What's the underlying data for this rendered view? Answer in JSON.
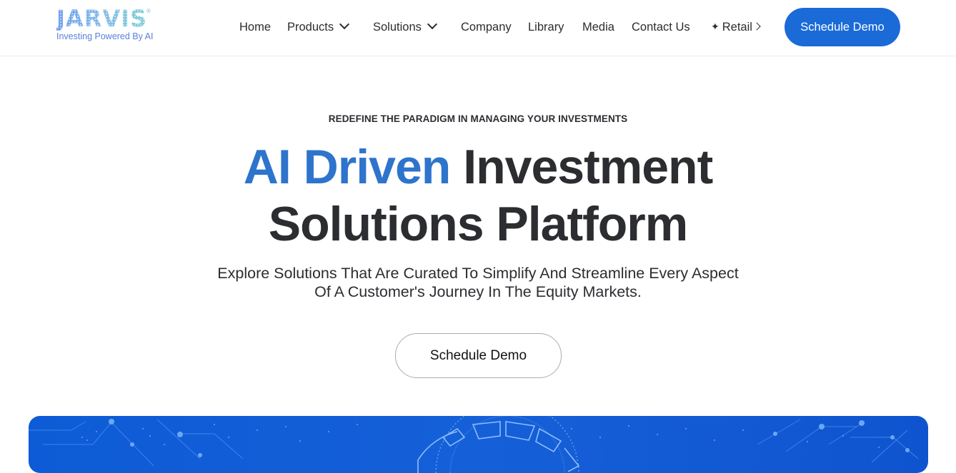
{
  "header": {
    "logo": {
      "wordmark": "JARVIS",
      "registered": "®",
      "tagline": "Investing Powered By AI"
    },
    "nav": [
      {
        "label": "Home",
        "has_dropdown": false
      },
      {
        "label": "Products",
        "has_dropdown": true
      },
      {
        "label": "Solutions",
        "has_dropdown": true
      },
      {
        "label": "Company",
        "has_dropdown": false
      },
      {
        "label": "Library",
        "has_dropdown": false
      },
      {
        "label": "Media",
        "has_dropdown": false
      },
      {
        "label": "Contact Us",
        "has_dropdown": false
      },
      {
        "label": "Retail",
        "icon": "sparkle-icon",
        "trailing_icon": "chevron-right-icon"
      }
    ],
    "cta_label": "Schedule Demo"
  },
  "hero": {
    "eyebrow": "REDEFINE THE PARADIGM IN MANAGING YOUR INVESTMENTS",
    "title_accent": "AI Driven",
    "title_rest_line1": "Investment",
    "title_line2": "Solutions Platform",
    "subtitle_line1": "Explore Solutions That Are Curated To Simplify And Streamline Every Aspect",
    "subtitle_line2": "Of A Customer's Journey In The Equity Markets.",
    "cta_label": "Schedule Demo"
  },
  "colors": {
    "accent": "#2e74cc",
    "primary_button": "#1a6ad8",
    "text": "#2b2d31",
    "banner": "#1560d8"
  }
}
